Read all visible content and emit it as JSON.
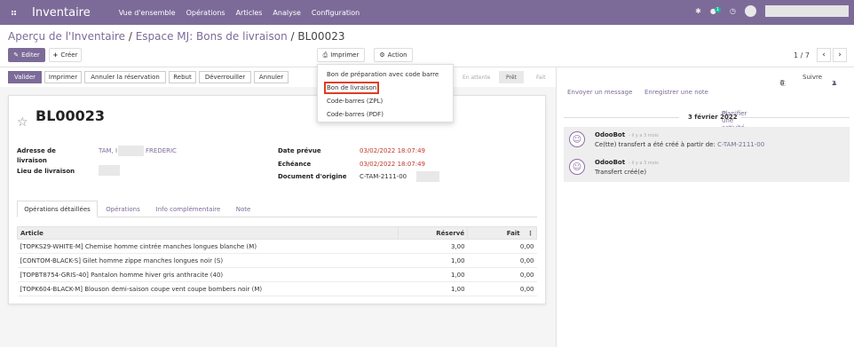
{
  "navbar": {
    "brand": "Inventaire",
    "menu": [
      "Vue d'ensemble",
      "Opérations",
      "Articles",
      "Analyse",
      "Configuration"
    ],
    "messages_badge": "1"
  },
  "breadcrumb": {
    "part1": "Aperçu de l'Inventaire",
    "part2": "Espace MJ: Bons de livraison",
    "current": "BL00023",
    "sep": " / "
  },
  "toolbar": {
    "edit": "Editer",
    "create": "Créer",
    "print": "Imprimer",
    "action": "Action",
    "pager": "1 / 7"
  },
  "print_menu": {
    "items": [
      "Bon de préparation avec code barre",
      "Bon de livraison",
      "Code-barres (ZPL)",
      "Code-barres (PDF)"
    ]
  },
  "statusbar": {
    "buttons": [
      "Valider",
      "Imprimer",
      "Annuler la réservation",
      "Rebut",
      "Déverrouiller",
      "Annuler"
    ],
    "stages": [
      "En attente",
      "Prêt",
      "Fait"
    ],
    "active_stage": "Prêt"
  },
  "record": {
    "name": "BL00023",
    "labels": {
      "delivery_address": "Adresse de livraison",
      "delivery_address_l1": "Adresse de",
      "delivery_address_l2": "livraison",
      "location": "Lieu de livraison",
      "scheduled_date": "Date prévue",
      "deadline": "Echéance",
      "origin": "Document d'origine"
    },
    "partner_first": "TAM, I",
    "partner_last": "FREDERIC",
    "scheduled_date": "03/02/2022 18:07:49",
    "deadline": "03/02/2022 18:07:49",
    "origin": "C-TAM-2111-00"
  },
  "tabs": [
    "Opérations détaillées",
    "Opérations",
    "Info complémentaire",
    "Note"
  ],
  "lines": {
    "headers": {
      "article": "Article",
      "reserved": "Réservé",
      "done": "Fait"
    },
    "rows": [
      {
        "article": "[TOPKS29-WHITE-M] Chemise homme cintrée manches longues blanche (M)",
        "reserved": "3,00",
        "done": "0,00"
      },
      {
        "article": "[CONTOM-BLACK-S] Gilet homme zippe manches longues noir (S)",
        "reserved": "1,00",
        "done": "0,00"
      },
      {
        "article": "[TOPBT8754-GRIS-40] Pantalon homme hiver gris anthracite (40)",
        "reserved": "1,00",
        "done": "0,00"
      },
      {
        "article": "[TOPK604-BLACK-M] Blouson demi-saison coupe vent coupe bombers noir (M)",
        "reserved": "1,00",
        "done": "0,00"
      }
    ]
  },
  "chatter": {
    "attachments": "0",
    "follow": "Suivre",
    "followers": "2",
    "send_message": "Envoyer un message",
    "log_note": "Enregistrer une note",
    "schedule_activity": "Planifier une activité",
    "date": "3 février 2022",
    "messages": [
      {
        "author": "OdooBot",
        "time": "- il y a 3 mois",
        "body": "Ce(tte) transfert a été créé à partir de: ",
        "link": "C-TAM-2111-00"
      },
      {
        "author": "OdooBot",
        "time": "- il y a 3 mois",
        "body": "Transfert créé(e)",
        "link": ""
      }
    ]
  },
  "colors": {
    "brand": "#7c6b98",
    "deadline": "#c0392b",
    "highlight": "#e03c21"
  }
}
